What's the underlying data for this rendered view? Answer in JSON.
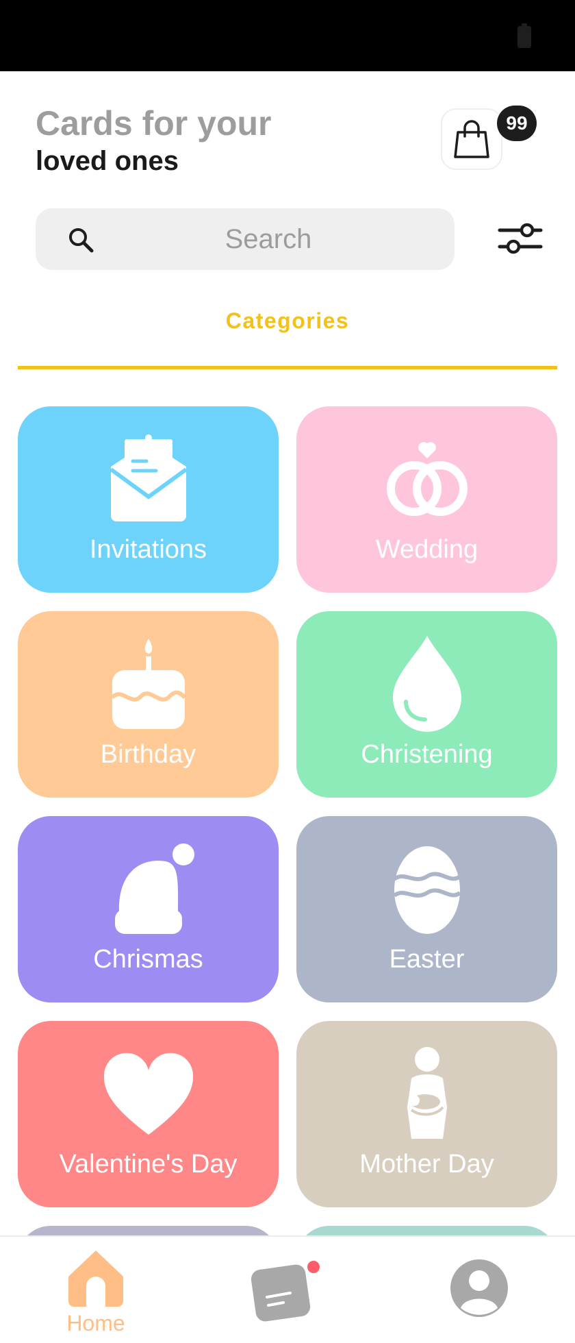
{
  "header": {
    "title_line1": "Cards for your",
    "title_line2": "loved ones",
    "cart_count": "99"
  },
  "search": {
    "placeholder": "Search",
    "value": ""
  },
  "tabs": {
    "active_label": "Categories",
    "accent_color": "#f2c21b"
  },
  "categories": [
    {
      "label": "Invitations",
      "icon": "envelope-icon",
      "color": "#6dd3fb"
    },
    {
      "label": "Wedding",
      "icon": "rings-icon",
      "color": "#ffc5dd"
    },
    {
      "label": "Birthday",
      "icon": "cake-icon",
      "color": "#ffca96"
    },
    {
      "label": "Christening",
      "icon": "drop-icon",
      "color": "#8debba"
    },
    {
      "label": "Chrismas",
      "icon": "santa-hat-icon",
      "color": "#9d8df3"
    },
    {
      "label": "Easter",
      "icon": "egg-icon",
      "color": "#adb5c9"
    },
    {
      "label": "Valentine's Day",
      "icon": "heart-icon",
      "color": "#ff8787"
    },
    {
      "label": "Mother Day",
      "icon": "mother-baby-icon",
      "color": "#d8cebf"
    }
  ],
  "peek_colors": [
    "#b5b6cc",
    "#a7d9d0"
  ],
  "bottom_nav": {
    "home_label": "Home",
    "home_color": "#ffbe86",
    "items": [
      "home-icon",
      "messages-icon",
      "profile-icon"
    ]
  }
}
